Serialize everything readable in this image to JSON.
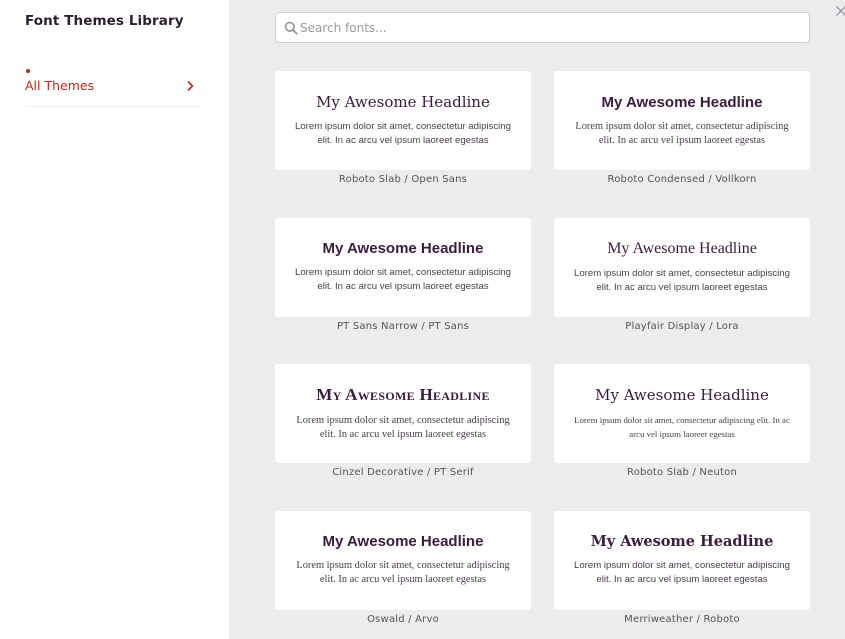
{
  "sidebar": {
    "title": "Font Themes Library",
    "items": [
      {
        "label": "All Themes",
        "active": true
      }
    ]
  },
  "search": {
    "placeholder": "Search fonts...",
    "value": ""
  },
  "themes": [
    {
      "headline": "My Awesome Headline",
      "body": "Lorem ipsum dolor sit amet, consectetur adipiscing elit. In ac arcu vel ipsum laoreet egestas",
      "caption": "Roboto Slab / Open Sans"
    },
    {
      "headline": "My Awesome Headline",
      "body": "Lorem ipsum dolor sit amet, consectetur adipiscing elit. In ac arcu vel ipsum laoreet egestas",
      "caption": "Roboto Condensed / Vollkorn"
    },
    {
      "headline": "My Awesome Headline",
      "body": "Lorem ipsum dolor sit amet, consectetur adipiscing elit. In ac arcu vel ipsum laoreet egestas",
      "caption": "PT Sans Narrow / PT Sans"
    },
    {
      "headline": "My Awesome Headline",
      "body": "Lorem ipsum dolor sit amet, consectetur adipiscing elit. In ac arcu vel ipsum laoreet egestas",
      "caption": "Playfair Display / Lora"
    },
    {
      "headline": "My Awesome Headline",
      "body": "Lorem ipsum dolor sit amet, consectetur adipiscing elit. In ac arcu vel ipsum laoreet egestas",
      "caption": "Cinzel Decorative / PT Serif"
    },
    {
      "headline": "My Awesome Headline",
      "body": "Lorem ipsum dolor sit amet, consectetur adipiscing elit. In ac arcu vel ipsum laoreet egestas",
      "caption": "Roboto Slab / Neuton"
    },
    {
      "headline": "My Awesome Headline",
      "body": "Lorem ipsum dolor sit amet, consectetur adipiscing elit. In ac arcu vel ipsum laoreet egestas",
      "caption": "Oswald / Arvo"
    },
    {
      "headline": "My Awesome Headline",
      "body": "Lorem ipsum dolor sit amet, consectetur adipiscing elit. In ac arcu vel ipsum laoreet egestas",
      "caption": "Merriweather / Roboto"
    }
  ],
  "icons": {
    "search": "search-icon",
    "close": "close-icon",
    "chevron": "chevron-right-icon"
  },
  "colors": {
    "accent": "#c2281b",
    "headline": "#3a1d3d",
    "panel_bg": "#ececef"
  }
}
